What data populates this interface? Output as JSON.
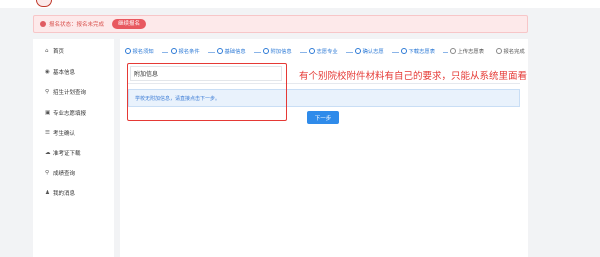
{
  "status": {
    "text": "报名状态：报名未完成",
    "button": "继续报名"
  },
  "sidebar": {
    "items": [
      {
        "icon": "⌂",
        "icon_name": "home-icon",
        "label": "首页"
      },
      {
        "icon": "◉",
        "icon_name": "user-icon",
        "label": "基本信息"
      },
      {
        "icon": "⚲",
        "icon_name": "search-icon",
        "label": "招生计划查询"
      },
      {
        "icon": "▣",
        "icon_name": "form-icon",
        "label": "专业志愿填报"
      },
      {
        "icon": "☰",
        "icon_name": "check-icon",
        "label": "考生确认"
      },
      {
        "icon": "☁",
        "icon_name": "download-icon",
        "label": "准考证下载"
      },
      {
        "icon": "⚲",
        "icon_name": "search-icon",
        "label": "成绩查询"
      },
      {
        "icon": "♟",
        "icon_name": "message-icon",
        "label": "我的消息"
      }
    ]
  },
  "steps": [
    {
      "label": "报名须知",
      "state": "done"
    },
    {
      "label": "报名条件",
      "state": "done"
    },
    {
      "label": "基础信息",
      "state": "done"
    },
    {
      "label": "附加信息",
      "state": "done"
    },
    {
      "label": "志愿专业",
      "state": "done"
    },
    {
      "label": "确认志愿",
      "state": "done"
    },
    {
      "label": "下载志愿表",
      "state": "done"
    },
    {
      "label": "上传志愿表",
      "state": "todo"
    },
    {
      "label": "报名完成",
      "state": "todo"
    }
  ],
  "panel": {
    "title": "附加信息",
    "info": "学校无附加信息，请直接点击下一步。",
    "next_button": "下一步"
  },
  "annotation": {
    "text": "有个别院校附件材料有自己的要求，只能从系统里面看",
    "color": "#e53935"
  },
  "colors": {
    "accent": "#2f8bea",
    "danger": "#e8585f"
  }
}
